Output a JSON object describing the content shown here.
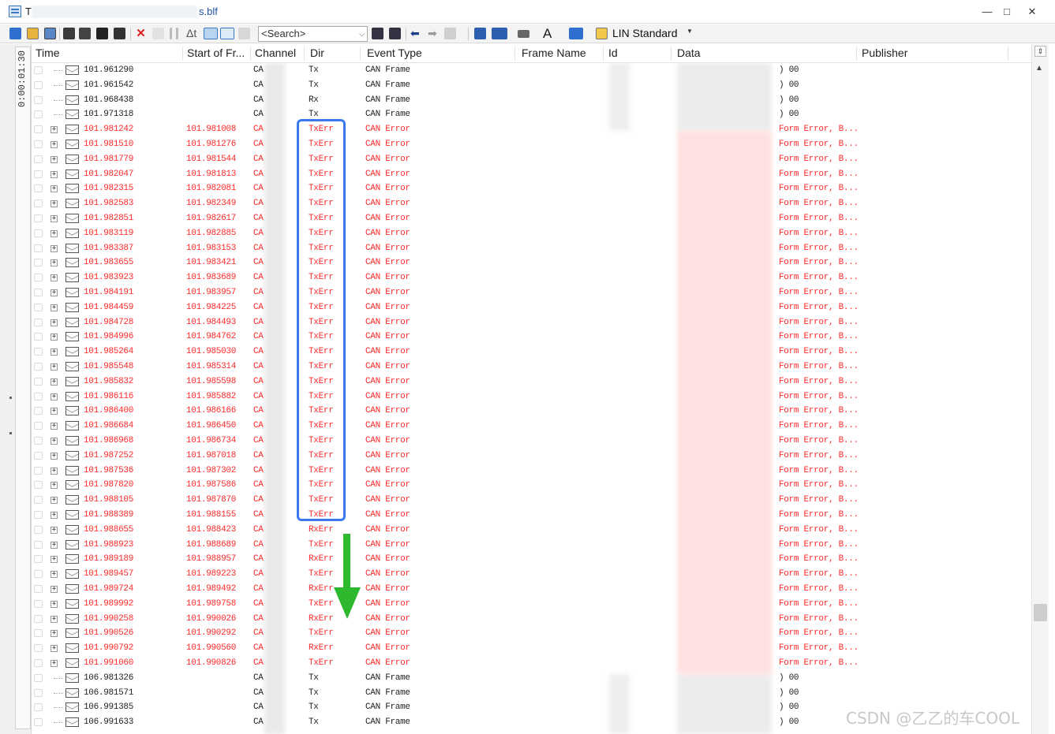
{
  "window": {
    "title_prefix": "T",
    "title_suffix": "s.blf",
    "controls": {
      "minimize": "—",
      "maximize": "□",
      "close": "✕"
    }
  },
  "toolbar": {
    "search_placeholder": "<Search>",
    "search_dropdown": "⌵",
    "lin_label": "LIN Standard",
    "lin_dropdown": "▼",
    "delta_label": "Δt",
    "font_label": "A",
    "icons": [
      "online-icon",
      "statistics-icon",
      "export-icon",
      "filter-icon",
      "filter-remove-icon",
      "filter-apply-icon",
      "binoculars-icon",
      "delete-icon",
      "clear-icon",
      "pause-icon",
      "delta-time-icon",
      "overwrite-icon",
      "chronological-icon",
      "columns-icon",
      "prev-icon",
      "next-icon",
      "marker-icon",
      "expand-icon",
      "database-icon",
      "layout-icon",
      "font-icon",
      "color-icon",
      "lin-icon"
    ]
  },
  "time_axis": {
    "label": "0:00:01:30"
  },
  "columns": {
    "time": "Time",
    "start_of_frame": "Start of Fr...",
    "channel": "Channel",
    "dir": "Dir",
    "event_type": "Event Type",
    "frame_name": "Frame Name",
    "id": "Id",
    "data": "Data",
    "publisher": "Publisher"
  },
  "rows": [
    {
      "kind": "frame",
      "time": "101.961290",
      "sof": "",
      "channel": "CA",
      "dir": "Tx",
      "event": "CAN Frame",
      "data": ") 00"
    },
    {
      "kind": "frame",
      "time": "101.961542",
      "sof": "",
      "channel": "CA",
      "dir": "Tx",
      "event": "CAN Frame",
      "data": ") 00"
    },
    {
      "kind": "frame",
      "time": "101.968438",
      "sof": "",
      "channel": "CA",
      "dir": "Rx",
      "event": "CAN Frame",
      "data": ") 00"
    },
    {
      "kind": "frame",
      "time": "101.971318",
      "sof": "",
      "channel": "CA",
      "dir": "Tx",
      "event": "CAN Frame",
      "data": ") 00"
    },
    {
      "kind": "err",
      "time": "101.981242",
      "sof": "101.981008",
      "channel": "CA",
      "dir": "TxErr",
      "event": "CAN Error",
      "data": "Form Error, B..."
    },
    {
      "kind": "err",
      "time": "101.981510",
      "sof": "101.981276",
      "channel": "CA",
      "dir": "TxErr",
      "event": "CAN Error",
      "data": "Form Error, B..."
    },
    {
      "kind": "err",
      "time": "101.981779",
      "sof": "101.981544",
      "channel": "CA",
      "dir": "TxErr",
      "event": "CAN Error",
      "data": "Form Error, B..."
    },
    {
      "kind": "err",
      "time": "101.982047",
      "sof": "101.981813",
      "channel": "CA",
      "dir": "TxErr",
      "event": "CAN Error",
      "data": "Form Error, B..."
    },
    {
      "kind": "err",
      "time": "101.982315",
      "sof": "101.982081",
      "channel": "CA",
      "dir": "TxErr",
      "event": "CAN Error",
      "data": "Form Error, B..."
    },
    {
      "kind": "err",
      "time": "101.982583",
      "sof": "101.982349",
      "channel": "CA",
      "dir": "TxErr",
      "event": "CAN Error",
      "data": "Form Error, B..."
    },
    {
      "kind": "err",
      "time": "101.982851",
      "sof": "101.982617",
      "channel": "CA",
      "dir": "TxErr",
      "event": "CAN Error",
      "data": "Form Error, B..."
    },
    {
      "kind": "err",
      "time": "101.983119",
      "sof": "101.982885",
      "channel": "CA",
      "dir": "TxErr",
      "event": "CAN Error",
      "data": "Form Error, B..."
    },
    {
      "kind": "err",
      "time": "101.983387",
      "sof": "101.983153",
      "channel": "CA",
      "dir": "TxErr",
      "event": "CAN Error",
      "data": "Form Error, B..."
    },
    {
      "kind": "err",
      "time": "101.983655",
      "sof": "101.983421",
      "channel": "CA",
      "dir": "TxErr",
      "event": "CAN Error",
      "data": "Form Error, B..."
    },
    {
      "kind": "err",
      "time": "101.983923",
      "sof": "101.983689",
      "channel": "CA",
      "dir": "TxErr",
      "event": "CAN Error",
      "data": "Form Error, B..."
    },
    {
      "kind": "err",
      "time": "101.984191",
      "sof": "101.983957",
      "channel": "CA",
      "dir": "TxErr",
      "event": "CAN Error",
      "data": "Form Error, B..."
    },
    {
      "kind": "err",
      "time": "101.984459",
      "sof": "101.984225",
      "channel": "CA",
      "dir": "TxErr",
      "event": "CAN Error",
      "data": "Form Error, B..."
    },
    {
      "kind": "err",
      "time": "101.984728",
      "sof": "101.984493",
      "channel": "CA",
      "dir": "TxErr",
      "event": "CAN Error",
      "data": "Form Error, B..."
    },
    {
      "kind": "err",
      "time": "101.984996",
      "sof": "101.984762",
      "channel": "CA",
      "dir": "TxErr",
      "event": "CAN Error",
      "data": "Form Error, B..."
    },
    {
      "kind": "err",
      "time": "101.985264",
      "sof": "101.985030",
      "channel": "CA",
      "dir": "TxErr",
      "event": "CAN Error",
      "data": "Form Error, B..."
    },
    {
      "kind": "err",
      "time": "101.985548",
      "sof": "101.985314",
      "channel": "CA",
      "dir": "TxErr",
      "event": "CAN Error",
      "data": "Form Error, B..."
    },
    {
      "kind": "err",
      "time": "101.985832",
      "sof": "101.985598",
      "channel": "CA",
      "dir": "TxErr",
      "event": "CAN Error",
      "data": "Form Error, B..."
    },
    {
      "kind": "err",
      "time": "101.986116",
      "sof": "101.985882",
      "channel": "CA",
      "dir": "TxErr",
      "event": "CAN Error",
      "data": "Form Error, B..."
    },
    {
      "kind": "err",
      "time": "101.986400",
      "sof": "101.986166",
      "channel": "CA",
      "dir": "TxErr",
      "event": "CAN Error",
      "data": "Form Error, B..."
    },
    {
      "kind": "err",
      "time": "101.986684",
      "sof": "101.986450",
      "channel": "CA",
      "dir": "TxErr",
      "event": "CAN Error",
      "data": "Form Error, B..."
    },
    {
      "kind": "err",
      "time": "101.986968",
      "sof": "101.986734",
      "channel": "CA",
      "dir": "TxErr",
      "event": "CAN Error",
      "data": "Form Error, B..."
    },
    {
      "kind": "err",
      "time": "101.987252",
      "sof": "101.987018",
      "channel": "CA",
      "dir": "TxErr",
      "event": "CAN Error",
      "data": "Form Error, B..."
    },
    {
      "kind": "err",
      "time": "101.987536",
      "sof": "101.987302",
      "channel": "CA",
      "dir": "TxErr",
      "event": "CAN Error",
      "data": "Form Error, B..."
    },
    {
      "kind": "err",
      "time": "101.987820",
      "sof": "101.987586",
      "channel": "CA",
      "dir": "TxErr",
      "event": "CAN Error",
      "data": "Form Error, B..."
    },
    {
      "kind": "err",
      "time": "101.988105",
      "sof": "101.987870",
      "channel": "CA",
      "dir": "TxErr",
      "event": "CAN Error",
      "data": "Form Error, B..."
    },
    {
      "kind": "err",
      "time": "101.988389",
      "sof": "101.988155",
      "channel": "CA",
      "dir": "TxErr",
      "event": "CAN Error",
      "data": "Form Error, B..."
    },
    {
      "kind": "err",
      "time": "101.988655",
      "sof": "101.988423",
      "channel": "CA",
      "dir": "RxErr",
      "event": "CAN Error",
      "data": "Form Error, B..."
    },
    {
      "kind": "err",
      "time": "101.988923",
      "sof": "101.988689",
      "channel": "CA",
      "dir": "TxErr",
      "event": "CAN Error",
      "data": "Form Error, B..."
    },
    {
      "kind": "err",
      "time": "101.989189",
      "sof": "101.988957",
      "channel": "CA",
      "dir": "RxErr",
      "event": "CAN Error",
      "data": "Form Error, B..."
    },
    {
      "kind": "err",
      "time": "101.989457",
      "sof": "101.989223",
      "channel": "CA",
      "dir": "TxErr",
      "event": "CAN Error",
      "data": "Form Error, B..."
    },
    {
      "kind": "err",
      "time": "101.989724",
      "sof": "101.989492",
      "channel": "CA",
      "dir": "RxErr",
      "event": "CAN Error",
      "data": "Form Error, B..."
    },
    {
      "kind": "err",
      "time": "101.989992",
      "sof": "101.989758",
      "channel": "CA",
      "dir": "TxErr",
      "event": "CAN Error",
      "data": "Form Error, B..."
    },
    {
      "kind": "err",
      "time": "101.990258",
      "sof": "101.990026",
      "channel": "CA",
      "dir": "RxErr",
      "event": "CAN Error",
      "data": "Form Error, B..."
    },
    {
      "kind": "err",
      "time": "101.990526",
      "sof": "101.990292",
      "channel": "CA",
      "dir": "TxErr",
      "event": "CAN Error",
      "data": "Form Error, B..."
    },
    {
      "kind": "err",
      "time": "101.990792",
      "sof": "101.990560",
      "channel": "CA",
      "dir": "RxErr",
      "event": "CAN Error",
      "data": "Form Error, B..."
    },
    {
      "kind": "err",
      "time": "101.991060",
      "sof": "101.990826",
      "channel": "CA",
      "dir": "TxErr",
      "event": "CAN Error",
      "data": "Form Error, B..."
    },
    {
      "kind": "frame",
      "time": "106.981326",
      "sof": "",
      "channel": "CA",
      "dir": "Tx",
      "event": "CAN Frame",
      "data": ") 00"
    },
    {
      "kind": "frame",
      "time": "106.981571",
      "sof": "",
      "channel": "CA",
      "dir": "Tx",
      "event": "CAN Frame",
      "data": ") 00"
    },
    {
      "kind": "frame",
      "time": "106.991385",
      "sof": "",
      "channel": "CA",
      "dir": "Tx",
      "event": "CAN Frame",
      "data": ") 00"
    },
    {
      "kind": "frame",
      "time": "106.991633",
      "sof": "",
      "channel": "CA",
      "dir": "Tx",
      "event": "CAN Frame",
      "data": ") 00"
    }
  ],
  "scrollbar": {
    "corner": "⇕",
    "up": "▲"
  },
  "annotations": {
    "box_color": "#3b79f0",
    "arrow_color": "#2db82d"
  },
  "colors": {
    "error_text": "#ff2a2a",
    "frame_text": "#222222",
    "error_highlight": "#ffd6d6"
  },
  "watermark": "CSDN @乙乙的车COOL"
}
